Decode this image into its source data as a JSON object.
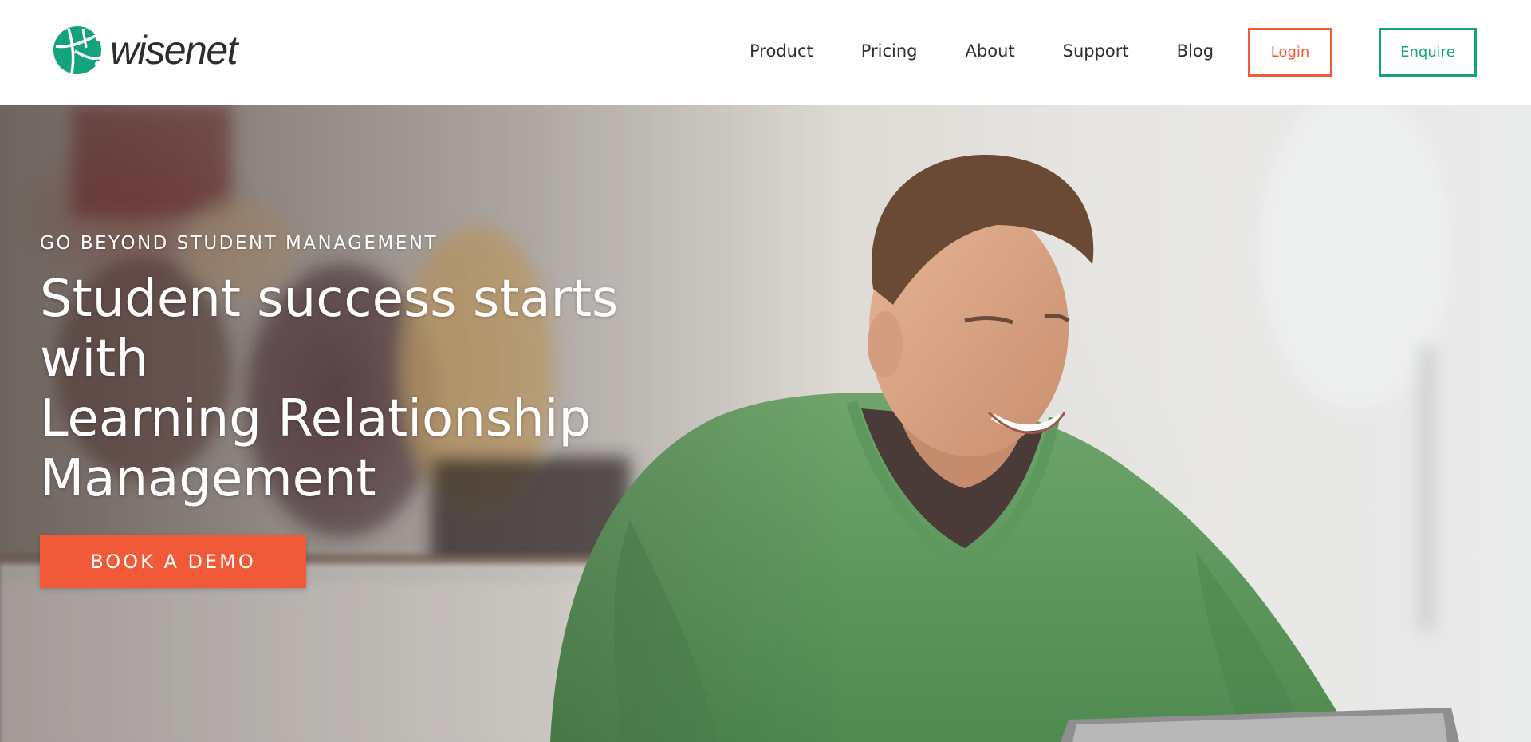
{
  "brand": {
    "name": "wisenet",
    "logo_icon": "wisenet-globe-icon",
    "colors": {
      "green": "#13a37d",
      "orange": "#f05a38",
      "text": "#2d2f36"
    }
  },
  "nav": {
    "items": [
      {
        "label": "Product"
      },
      {
        "label": "Pricing"
      },
      {
        "label": "About"
      },
      {
        "label": "Support"
      },
      {
        "label": "Blog"
      }
    ],
    "login_label": "Login",
    "enquire_label": "Enquire"
  },
  "hero": {
    "eyebrow": "GO BEYOND STUDENT MANAGEMENT",
    "headline_lines": [
      "Student success starts with",
      "Learning Relationship",
      "Management"
    ],
    "cta_label": "BOOK A DEMO"
  }
}
